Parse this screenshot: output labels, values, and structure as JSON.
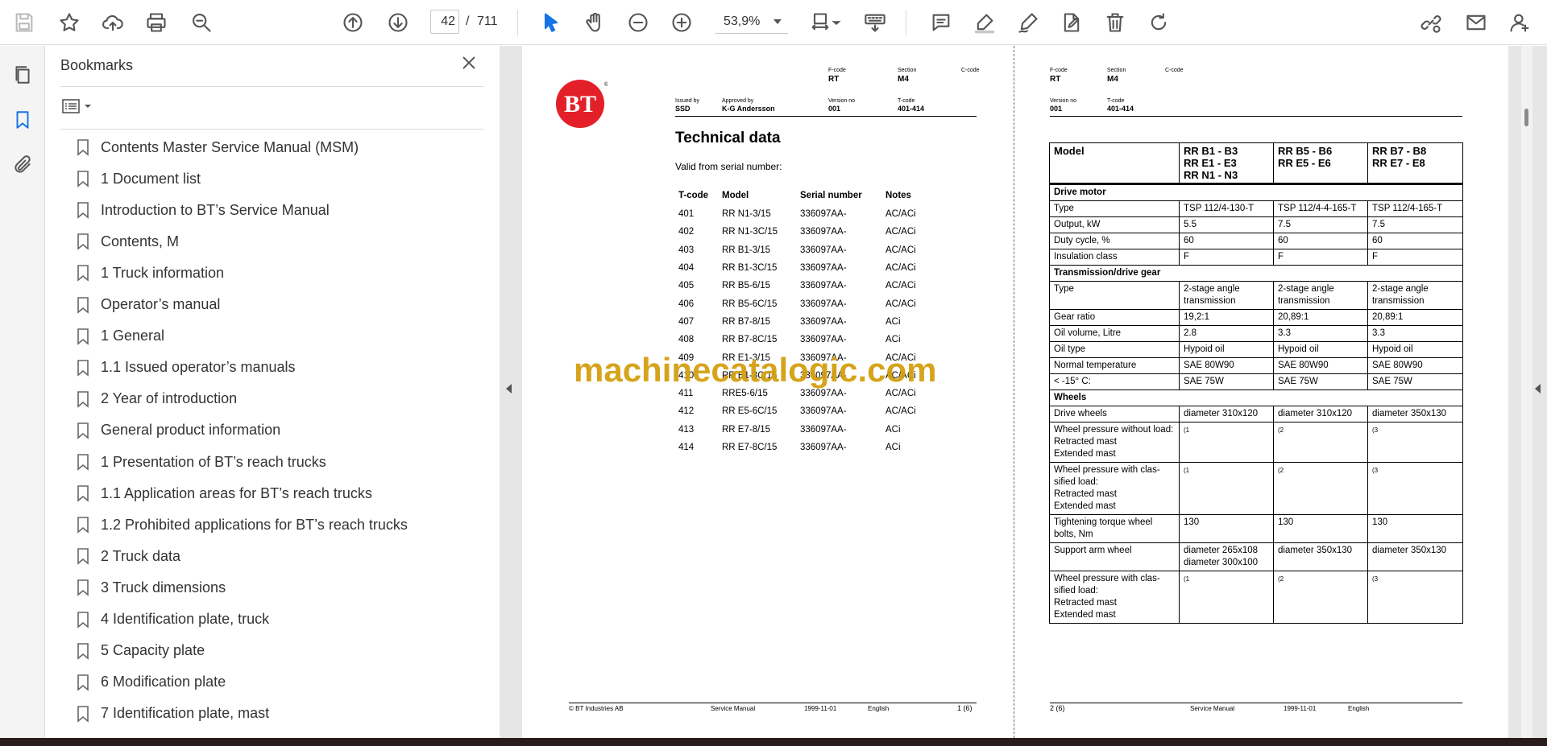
{
  "toolbar": {
    "current_page": "42",
    "slash": "/",
    "total_pages": "711",
    "zoom": "53,9%"
  },
  "bookmarks": {
    "title": "Bookmarks",
    "items": [
      "Contents Master Service Manual (MSM)",
      "1 Document list",
      "Introduction to BT’s Service Manual",
      "Contents, M",
      "1 Truck information",
      "Operator’s manual",
      "1 General",
      "1.1 Issued operator’s manuals",
      "2 Year of introduction",
      "General product information",
      "1 Presentation of BT’s reach trucks",
      "1.1 Application areas for BT’s reach trucks",
      "1.2 Prohibited applications for BT’s reach trucks",
      "2 Truck data",
      "3 Truck dimensions",
      "4 Identification plate, truck",
      "5 Capacity plate",
      "6 Modification plate",
      "7 Identification plate, mast"
    ]
  },
  "page1": {
    "logo_text": "BT",
    "logo_reg": "®",
    "meta": {
      "fcode_label": "F-code",
      "fcode": "RT",
      "section_label": "Section",
      "section": "M4",
      "ccode_label": "C-code",
      "issued_label": "Issued by",
      "issued": "SSD",
      "approved_label": "Approved by",
      "approved": "K-G Andersson",
      "version_label": "Version no",
      "version": "001",
      "tcode_label": "T-code",
      "tcode": "401-414"
    },
    "title": "Technical data",
    "valid_from": "Valid from serial number:",
    "table_headers": [
      "T-code",
      "Model",
      "Serial number",
      "Notes"
    ],
    "rows": [
      [
        "401",
        "RR N1-3/15",
        "336097AA-",
        "AC/ACi"
      ],
      [
        "402",
        "RR N1-3C/15",
        "336097AA-",
        "AC/ACi"
      ],
      [
        "403",
        "RR B1-3/15",
        "336097AA-",
        "AC/ACi"
      ],
      [
        "404",
        "RR B1-3C/15",
        "336097AA-",
        "AC/ACi"
      ],
      [
        "405",
        "RR B5-6/15",
        "336097AA-",
        "AC/ACi"
      ],
      [
        "406",
        "RR B5-6C/15",
        "336097AA-",
        "AC/ACi"
      ],
      [
        "407",
        "RR B7-8/15",
        "336097AA-",
        "ACi"
      ],
      [
        "408",
        "RR B7-8C/15",
        "336097AA-",
        "ACi"
      ],
      [
        "409",
        "RR E1-3/15",
        "336097AA-",
        "AC/ACi"
      ],
      [
        "410",
        "RR E1-3C/15",
        "336097AA-",
        "AC/ACi"
      ],
      [
        "411",
        "RRE5-6/15",
        "336097AA-",
        "AC/ACi"
      ],
      [
        "412",
        "RR E5-6C/15",
        "336097AA-",
        "AC/ACi"
      ],
      [
        "413",
        "RR E7-8/15",
        "336097AA-",
        "ACi"
      ],
      [
        "414",
        "RR E7-8C/15",
        "336097AA-",
        "ACi"
      ]
    ],
    "footer": {
      "copyright": "© BT Industries AB",
      "manual": "Service Manual",
      "date": "1999-11-01",
      "language": "English",
      "page": "1 (6)"
    }
  },
  "page2": {
    "meta": {
      "fcode_label": "F-code",
      "fcode": "RT",
      "section_label": "Section",
      "section": "M4",
      "ccode_label": "C-code",
      "version_label": "Version no",
      "version": "001",
      "tcode_label": "T-code",
      "tcode": "401-414"
    },
    "header": {
      "model": "Model",
      "col1": [
        "RR B1 - B3",
        "RR E1 - E3",
        "RR N1 - N3"
      ],
      "col2": [
        "RR B5 - B6",
        "RR E5 - E6"
      ],
      "col3": [
        "RR B7 - B8",
        "RR E7 - E8"
      ]
    },
    "sections": {
      "drive_motor": "Drive motor",
      "transmission": "Transmission/drive gear",
      "wheels": "Wheels"
    },
    "rows": {
      "type": [
        "Type",
        "TSP 112/4-130-T",
        "TSP 112/4-4-165-T",
        "TSP 112/4-165-T"
      ],
      "output": [
        "Output, kW",
        "5.5",
        "7.5",
        "7.5"
      ],
      "duty": [
        "Duty cycle, %",
        "60",
        "60",
        "60"
      ],
      "insulation": [
        "Insulation class",
        "F",
        "F",
        "F"
      ],
      "trans_type": [
        "Type",
        "2-stage angle transmission",
        "2-stage angle transmission",
        "2-stage angle transmission"
      ],
      "gear_ratio": [
        "Gear ratio",
        "19,2:1",
        "20,89:1",
        "20,89:1"
      ],
      "oil_volume": [
        "Oil volume, Litre",
        "2.8",
        "3.3",
        "3.3"
      ],
      "oil_type": [
        "Oil type",
        "Hypoid oil",
        "Hypoid oil",
        "Hypoid oil"
      ],
      "normal_temp": [
        "Normal temperature",
        "SAE 80W90",
        "SAE 80W90",
        "SAE 80W90"
      ],
      "low_temp": [
        "< -15° C:",
        "SAE 75W",
        "SAE 75W",
        "SAE 75W"
      ],
      "drive_wheels": [
        "Drive wheels",
        "diameter 310x120",
        "diameter 310x120",
        "diameter 350x130"
      ],
      "wp_without": [
        "Wheel pressure without load:",
        "(1",
        "(2",
        "(3"
      ],
      "wp_without_sub": [
        "Retracted mast",
        "Extended mast"
      ],
      "wp_with1": [
        "Wheel pressure with clas-sified load:",
        "(1",
        "(2",
        "(3"
      ],
      "wp_with1_sub": [
        "Retracted mast",
        "Extended mast"
      ],
      "torque": [
        "Tightening torque wheel bolts, Nm",
        "130",
        "130",
        "130"
      ],
      "support": [
        "Support arm wheel",
        "diameter 265x108",
        "diameter 350x130",
        "diameter 350x130"
      ],
      "support_extra": "diameter 300x100",
      "wp_with2": [
        "Wheel pressure with clas-sified load:",
        "(1",
        "(2",
        "(3"
      ],
      "wp_with2_sub": [
        "Retracted mast",
        "Extended mast"
      ]
    },
    "footer": {
      "page": "2 (6)",
      "manual": "Service Manual",
      "date": "1999-11-01",
      "language": "English"
    }
  },
  "watermark": "machinecatalogic.com",
  "colors": {
    "accent": "#1473e6",
    "logo_red": "#e3202a",
    "watermark": "#d4a010"
  }
}
